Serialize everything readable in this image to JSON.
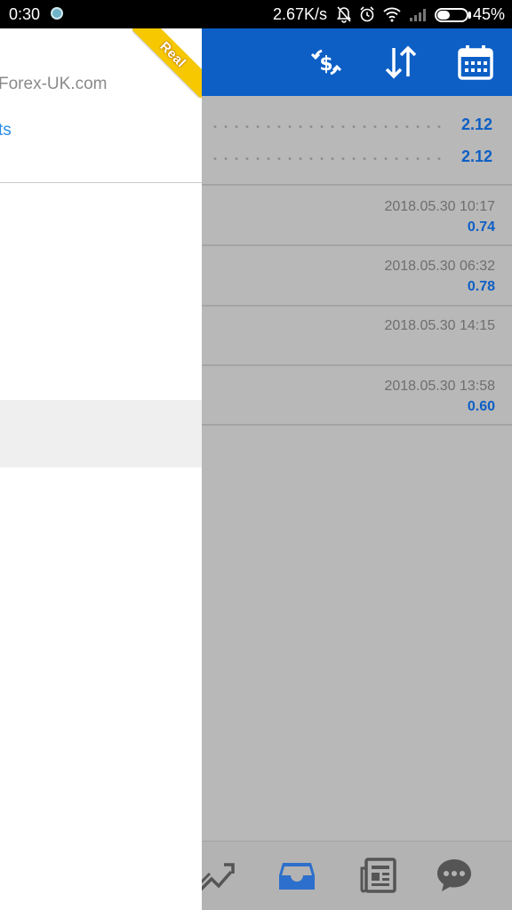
{
  "status_bar": {
    "time": "0:30",
    "net_speed": "2.67K/s",
    "battery_percent_text": "45%",
    "battery_level": 0.45
  },
  "toolbar": {
    "icons": [
      "currency-exchange-icon",
      "sort-icon",
      "calendar-icon"
    ]
  },
  "drawer": {
    "account_domain": "Forex-UK.com",
    "link_fragment": "ts",
    "badge": "Real"
  },
  "summary_rows": [
    {
      "value": "2.12"
    },
    {
      "value": "2.12"
    }
  ],
  "history_rows": [
    {
      "date": "2018.05.30 10:17",
      "value": "0.74"
    },
    {
      "date": "2018.05.30 06:32",
      "value": "0.78"
    },
    {
      "date": "2018.05.30 14:15",
      "value": ""
    },
    {
      "date": "2018.05.30 13:58",
      "value": "0.60"
    }
  ],
  "bottom_nav": {
    "icons": [
      "chart-icon",
      "inbox-icon",
      "news-icon",
      "chat-icon"
    ],
    "active": "inbox-icon"
  },
  "colors": {
    "accent": "#0d5fc5",
    "badge": "#f7c800",
    "link": "#2a8ce8"
  }
}
